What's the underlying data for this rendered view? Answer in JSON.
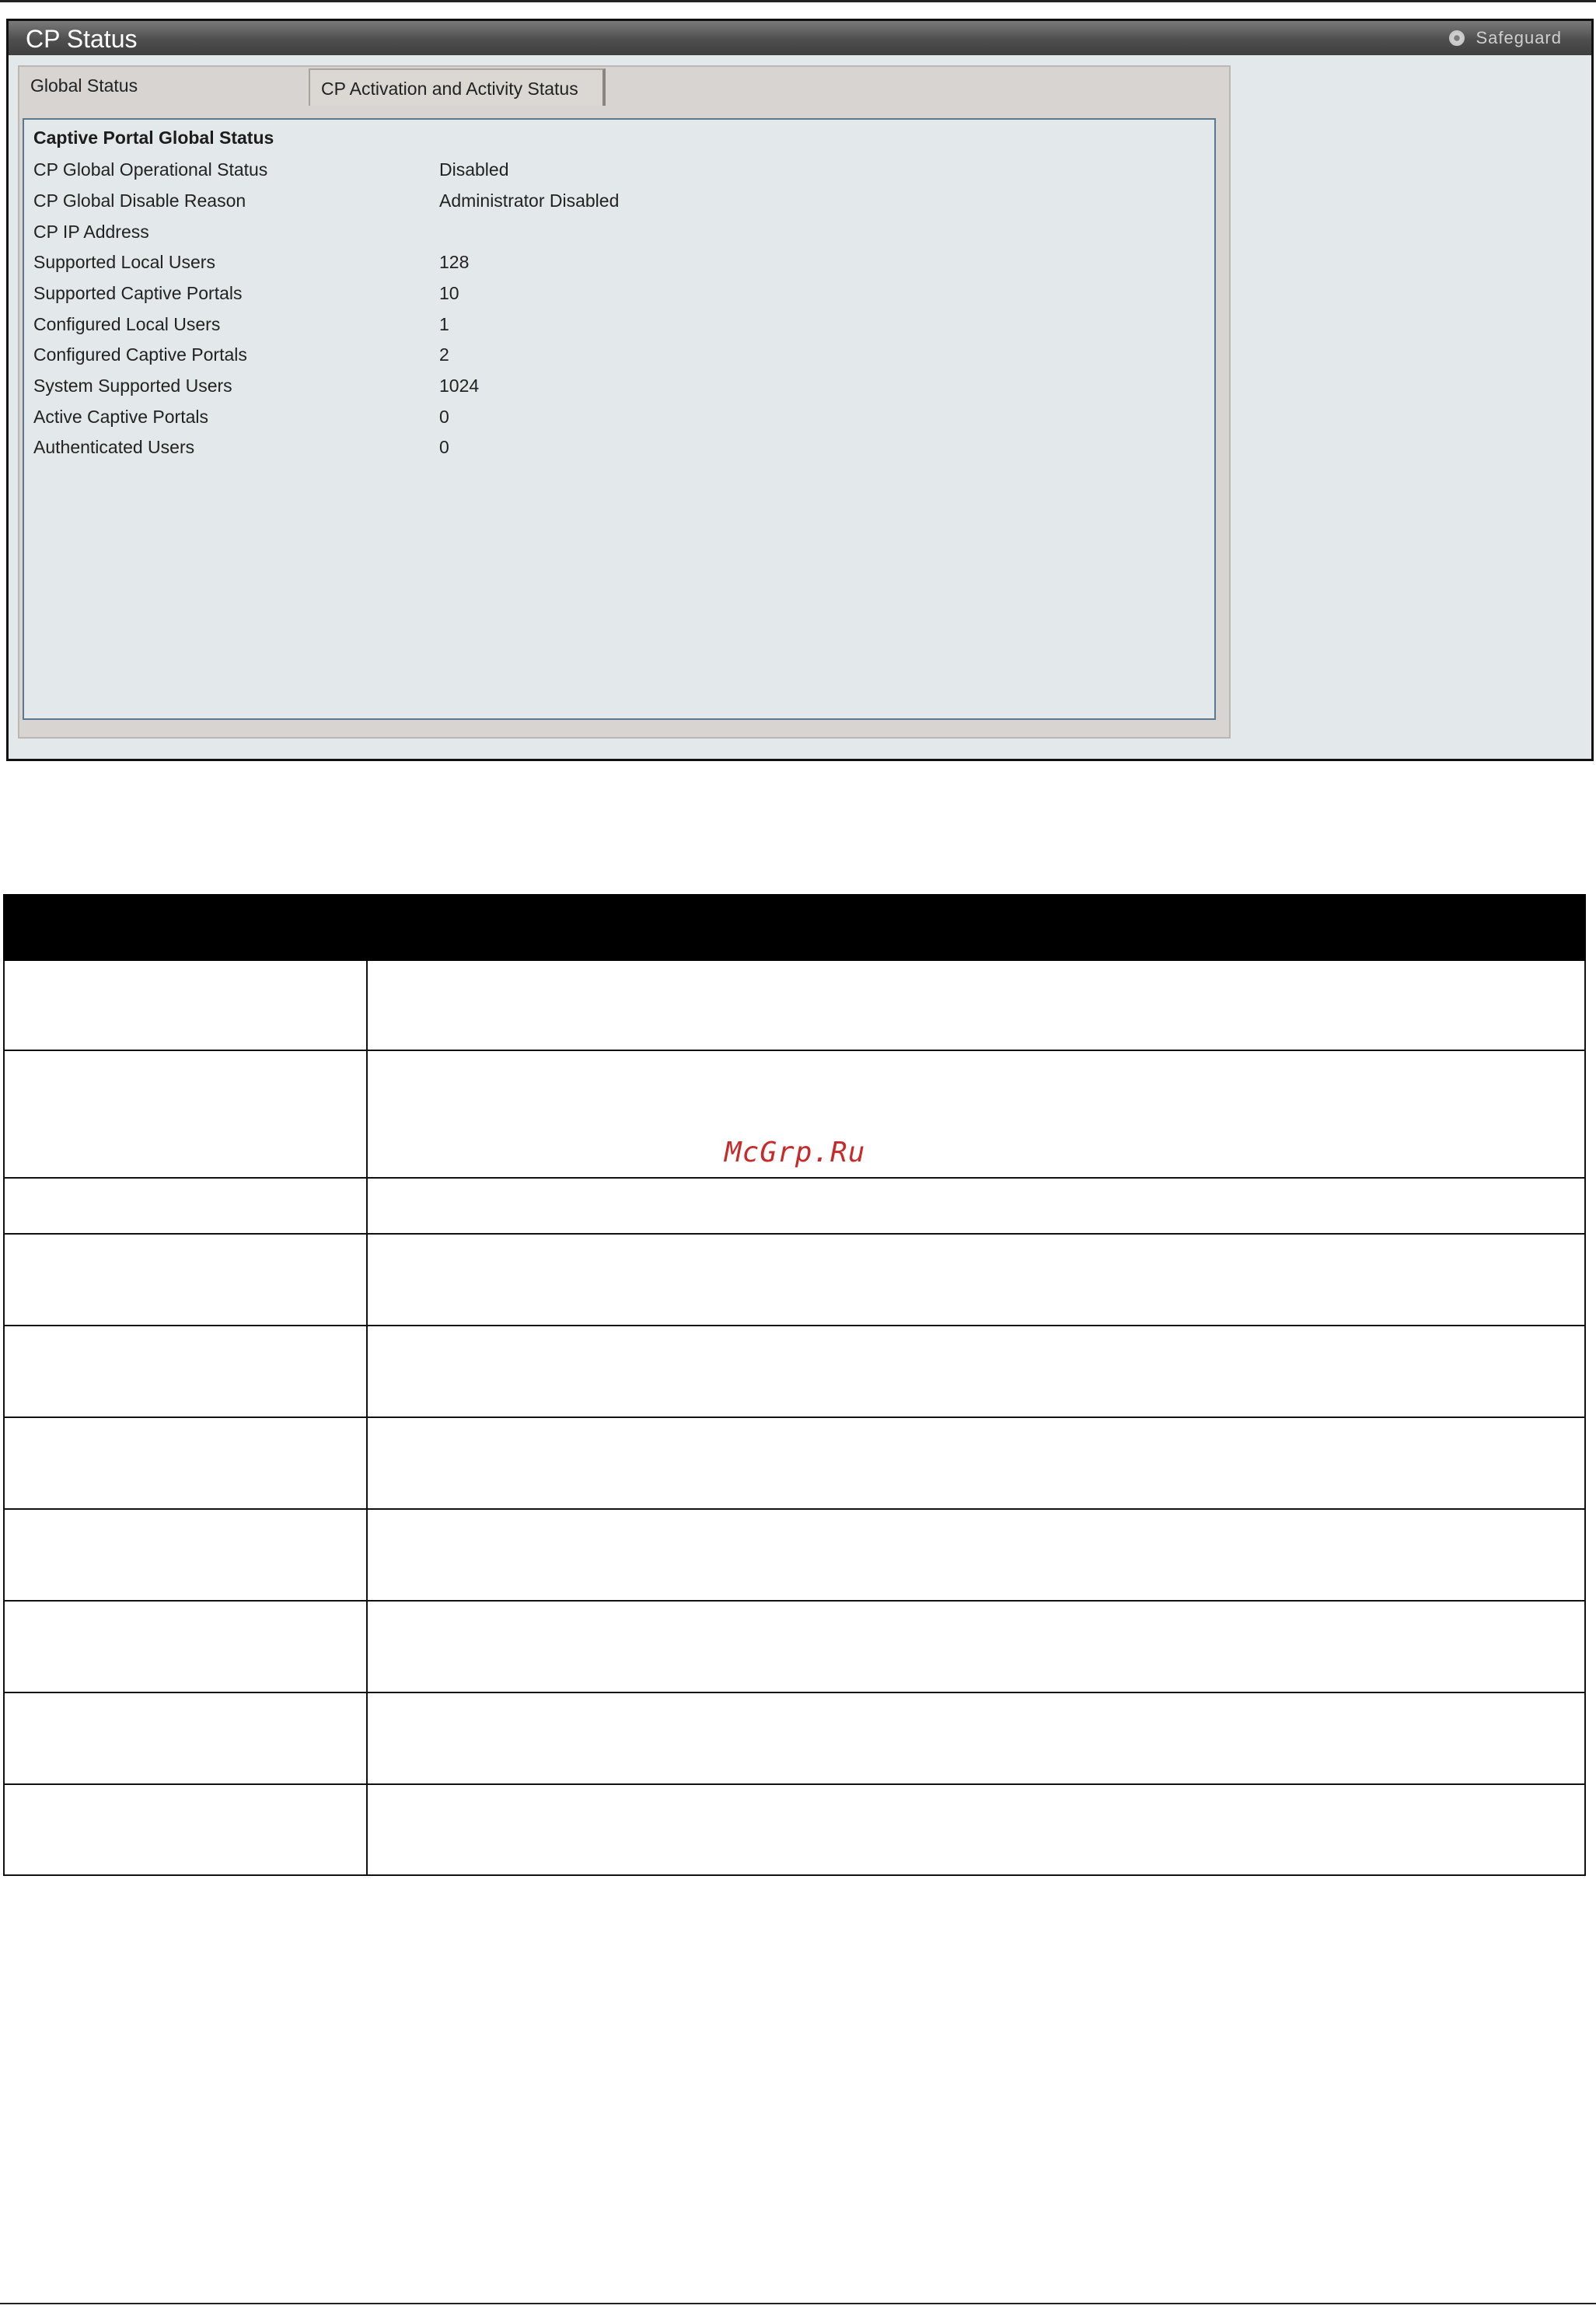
{
  "window": {
    "title": "CP Status",
    "safeguard_label": "Safeguard"
  },
  "tabs": [
    {
      "label": "Global Status",
      "active": true
    },
    {
      "label": "CP Activation and Activity Status",
      "active": false
    }
  ],
  "global_status": {
    "section_title": "Captive Portal Global Status",
    "rows": [
      {
        "label": "CP Global Operational Status",
        "value": "Disabled"
      },
      {
        "label": "CP Global Disable Reason",
        "value": "Administrator Disabled"
      },
      {
        "label": "CP IP Address",
        "value": ""
      },
      {
        "label": "Supported Local Users",
        "value": "128"
      },
      {
        "label": "Supported Captive Portals",
        "value": "10"
      },
      {
        "label": "Configured Local Users",
        "value": "1"
      },
      {
        "label": "Configured Captive Portals",
        "value": "2"
      },
      {
        "label": "System Supported Users",
        "value": "1024"
      },
      {
        "label": "Active Captive Portals",
        "value": "0"
      },
      {
        "label": "Authenticated Users",
        "value": "0"
      }
    ]
  },
  "watermark": "McGrp.Ru"
}
